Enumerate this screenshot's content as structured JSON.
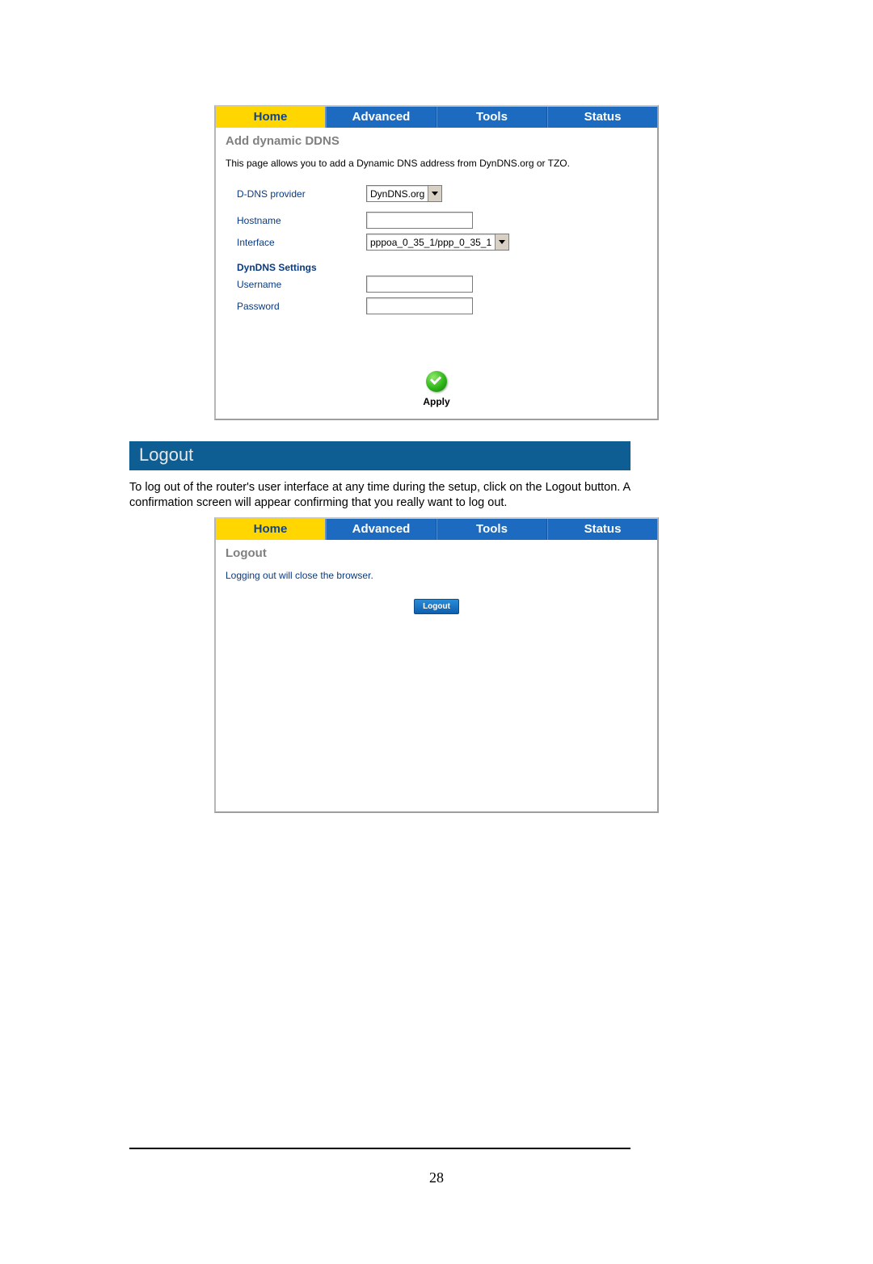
{
  "tabs": {
    "home": "Home",
    "advanced": "Advanced",
    "tools": "Tools",
    "status": "Status"
  },
  "ddns_panel": {
    "title": "Add dynamic DDNS",
    "intro": "This page allows you to add a Dynamic DNS address from DynDNS.org or TZO.",
    "labels": {
      "provider": "D-DNS provider",
      "hostname": "Hostname",
      "interface": "Interface",
      "section": "DynDNS Settings",
      "username": "Username",
      "password": "Password"
    },
    "values": {
      "provider_selected": "DynDNS.org",
      "interface_selected": "pppoa_0_35_1/ppp_0_35_1"
    },
    "apply_label": "Apply"
  },
  "section_heading": "Logout",
  "logout_paragraph": "To log out of the router's user interface at any time during the setup, click on the Logout button.  A confirmation screen will appear confirming that you really want to log out.",
  "logout_panel": {
    "title": "Logout",
    "message": "Logging out will close the browser.",
    "button": "Logout"
  },
  "page_number": "28"
}
